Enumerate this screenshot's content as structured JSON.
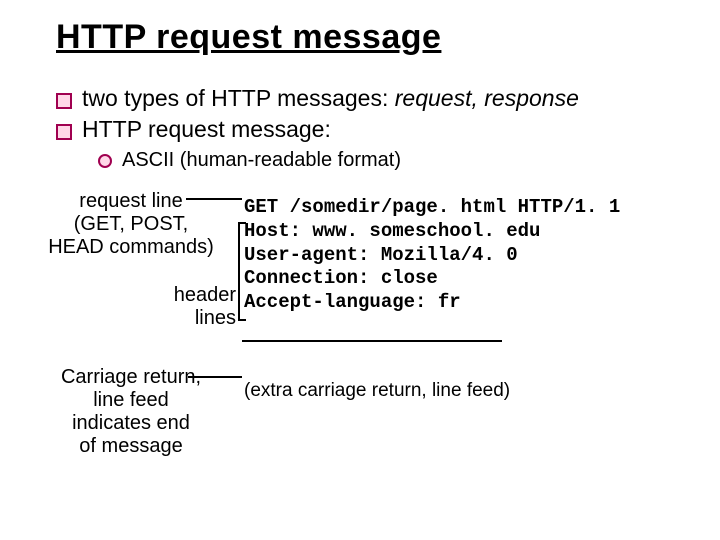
{
  "title": "HTTP request message",
  "bullets": {
    "b1_pre": "two types of HTTP messages: ",
    "b1_em": "request, response",
    "b2": "HTTP request message:"
  },
  "sub": "ASCII (human-readable format)",
  "labels": {
    "request_line": "request line\n(GET, POST,\nHEAD commands)",
    "header_lines": "header\nlines",
    "carriage_return": "Carriage return,\nline feed\nindicates end\nof message",
    "extra": "(extra carriage return, line feed)"
  },
  "code": {
    "l1": "GET /somedir/page. html HTTP/1. 1",
    "l2": "Host: www. someschool. edu",
    "l3": "User-agent: Mozilla/4. 0",
    "l4": "Connection: close",
    "l5": "Accept-language: fr"
  }
}
